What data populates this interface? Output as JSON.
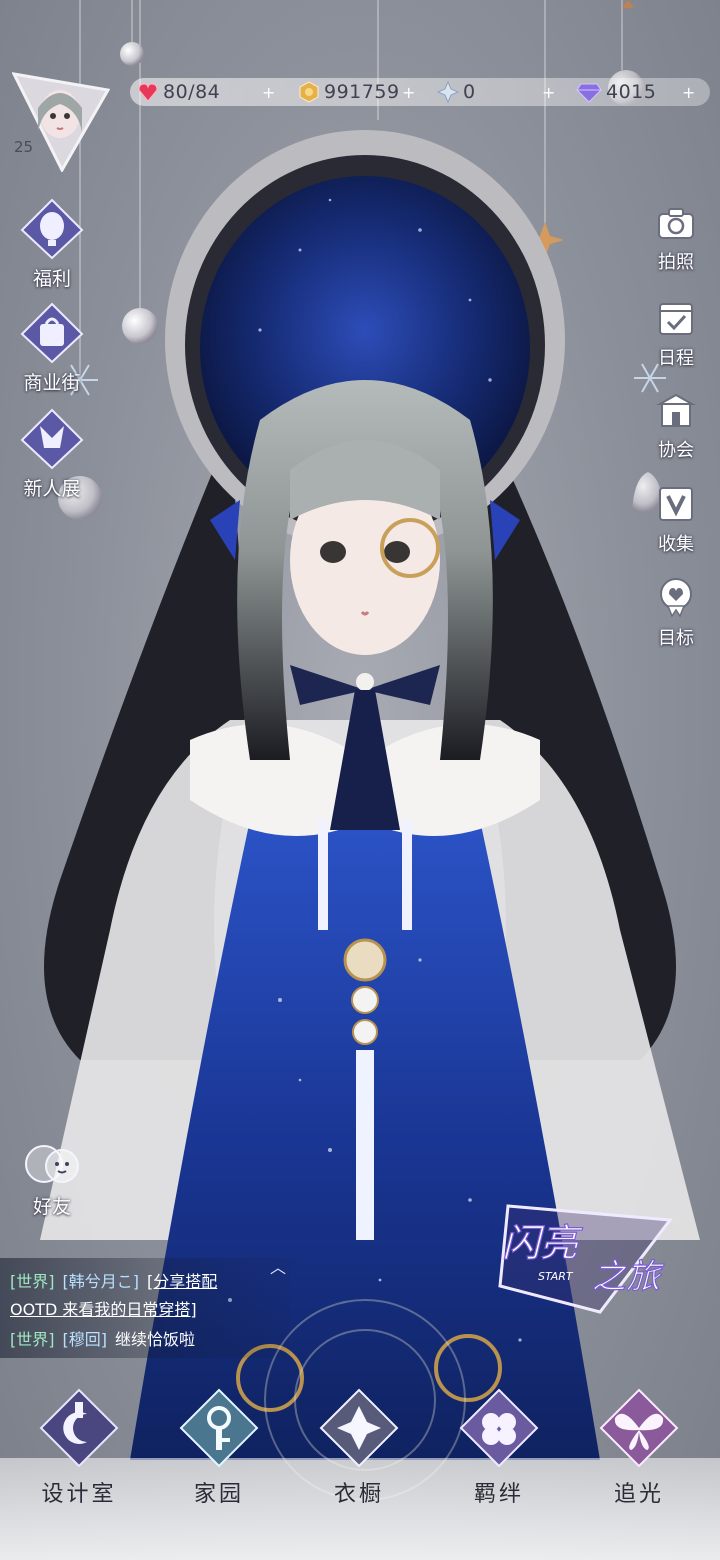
{
  "resources": {
    "stamina": "80/84",
    "coins": "991759",
    "crystals": "0",
    "diamonds": "4015",
    "plus": "+"
  },
  "player": {
    "level": "25"
  },
  "left_menu": [
    {
      "label": "福利",
      "icon": "balloon-icon"
    },
    {
      "label": "商业街",
      "icon": "shopping-bag-icon"
    },
    {
      "label": "新人展",
      "icon": "trophy-icon"
    }
  ],
  "right_menu": [
    {
      "label": "拍照",
      "icon": "camera-icon"
    },
    {
      "label": "日程",
      "icon": "calendar-check-icon"
    },
    {
      "label": "协会",
      "icon": "guild-building-icon"
    },
    {
      "label": "收集",
      "icon": "collection-v-icon"
    },
    {
      "label": "目标",
      "icon": "target-badge-icon"
    }
  ],
  "friends": {
    "label": "好友"
  },
  "chat": {
    "line1_tag": "[世界]",
    "line1_name": "[韩兮月こ]",
    "line1_msg": "[分享搭配",
    "line2_msg": "OOTD 来看我的日常穿搭]",
    "line3_tag": "[世界]",
    "line3_name": "[穆回]",
    "line3_msg": "继续恰饭啦"
  },
  "banner": {
    "title_a": "闪亮",
    "title_b": "之旅",
    "subtitle": "START"
  },
  "bottom_nav": [
    {
      "label": "设计室",
      "icon": "design-studio-icon"
    },
    {
      "label": "家园",
      "icon": "home-key-icon"
    },
    {
      "label": "衣橱",
      "icon": "wardrobe-crystal-icon"
    },
    {
      "label": "羁绊",
      "icon": "bond-clover-icon"
    },
    {
      "label": "追光",
      "icon": "butterfly-icon"
    }
  ],
  "colors": {
    "heart": "#e8385a",
    "coin": "#e6b04a",
    "diamond": "#8a6fe0",
    "dress": "#1f3f9a"
  }
}
